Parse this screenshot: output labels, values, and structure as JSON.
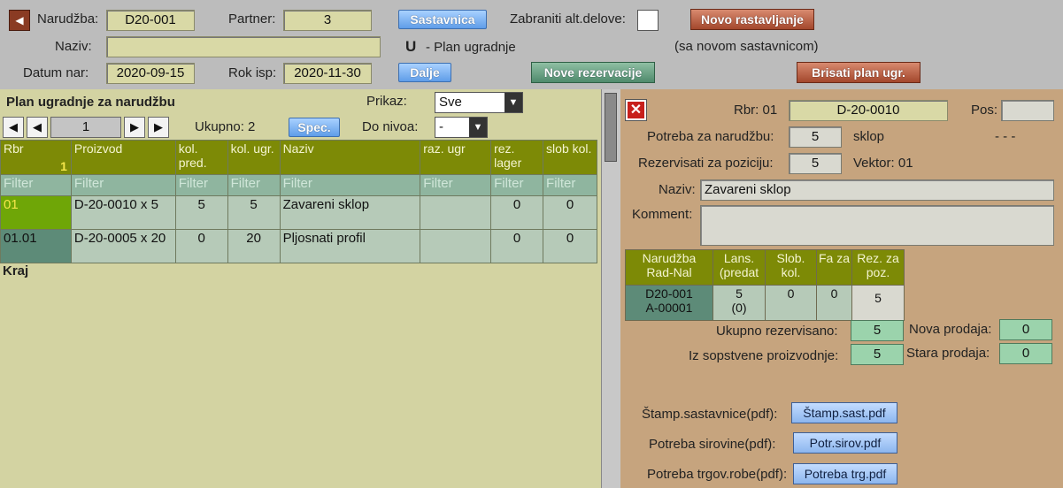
{
  "header": {
    "narudzba_label": "Narudžba:",
    "narudzba_value": "D20-001",
    "partner_label": "Partner:",
    "partner_value": "3",
    "sastavnica_button": "Sastavnica",
    "zabraniti_label": "Zabraniti alt.delove:",
    "novo_rastavljanje_button": "Novo rastavljanje",
    "naziv_label": "Naziv:",
    "naziv_value": "",
    "mode_letter": "U",
    "mode_text": "- Plan ugradnje",
    "sa_novom_text": "(sa novom sastavnicom)",
    "datum_label": "Datum nar:",
    "datum_value": "2020-09-15",
    "rok_label": "Rok isp:",
    "rok_value": "2020-11-30",
    "dalje_button": "Dalje",
    "nove_rezervacije_button": "Nove rezervacije",
    "brisati_button": "Brisati plan ugr."
  },
  "left": {
    "title": "Plan ugradnje za narudžbu",
    "prikaz_label": "Prikaz:",
    "prikaz_value": "Sve",
    "page_value": "1",
    "ukupno_text": "Ukupno: 2",
    "spec_button": "Spec.",
    "do_nivoa_label": "Do nivoa:",
    "do_nivoa_value": "-",
    "columns": {
      "rbr": "Rbr",
      "rbr_count": "1",
      "proizvod": "Proizvod",
      "kol_pred": "kol. pred.",
      "kol_ugr": "kol. ugr.",
      "naziv": "Naziv",
      "raz_ugr": "raz. ugr",
      "rez_lager": "rez. lager",
      "slob_kol": "slob kol."
    },
    "filter_text": "Filter",
    "rows": [
      {
        "rbr": "01",
        "proizvod": "D-20-0010 x 5",
        "kol_pred": "5",
        "kol_ugr": "5",
        "naziv": "Zavareni sklop",
        "raz_ugr": "",
        "rez_lager": "0",
        "slob_kol": "0"
      },
      {
        "rbr": "01.01",
        "proizvod": "D-20-0005 x 20",
        "kol_pred": "0",
        "kol_ugr": "20",
        "naziv": "Pljosnati profil",
        "raz_ugr": "",
        "rez_lager": "0",
        "slob_kol": "0"
      }
    ],
    "kraj": "Kraj"
  },
  "right": {
    "rbr_label": "Rbr: 01",
    "rbr_value": "D-20-0010",
    "pos_label": "Pos:",
    "pos_value": "",
    "potreba_label": "Potreba za narudžbu:",
    "potreba_value": "5",
    "potreba_unit": "sklop",
    "dashes": "- - -",
    "rezervisati_label": "Rezervisati za poziciju:",
    "rezervisati_value": "5",
    "vektor_text": "Vektor: 01",
    "naziv_label": "Naziv:",
    "naziv_value": "Zavareni sklop",
    "komment_label": "Komment:",
    "komment_value": "",
    "rez_table": {
      "headers": [
        "Narudžba Rad-Nal",
        "Lans. (predat",
        "Slob. kol.",
        "Fa za",
        "Rez. za poz."
      ],
      "row": {
        "nar1": "D20-001",
        "nar2": "A-00001",
        "lans1": "5",
        "lans2": "(0)",
        "slob": "0",
        "faza": "0",
        "rez": "5"
      }
    },
    "ukupno_rez_label": "Ukupno rezervisano:",
    "ukupno_rez_value": "5",
    "iz_sops_label": "Iz sopstvene proizvodnje:",
    "iz_sops_value": "5",
    "nova_prodaja_label": "Nova prodaja:",
    "nova_prodaja_value": "0",
    "stara_prodaja_label": "Stara prodaja:",
    "stara_prodaja_value": "0",
    "pdf": [
      {
        "label": "Štamp.sastavnice(pdf):",
        "button": "Štamp.sast.pdf"
      },
      {
        "label": "Potreba sirovine(pdf):",
        "button": "Potr.sirov.pdf"
      },
      {
        "label": "Potreba trgov.robe(pdf):",
        "button": "Potreba trg.pdf"
      }
    ]
  }
}
